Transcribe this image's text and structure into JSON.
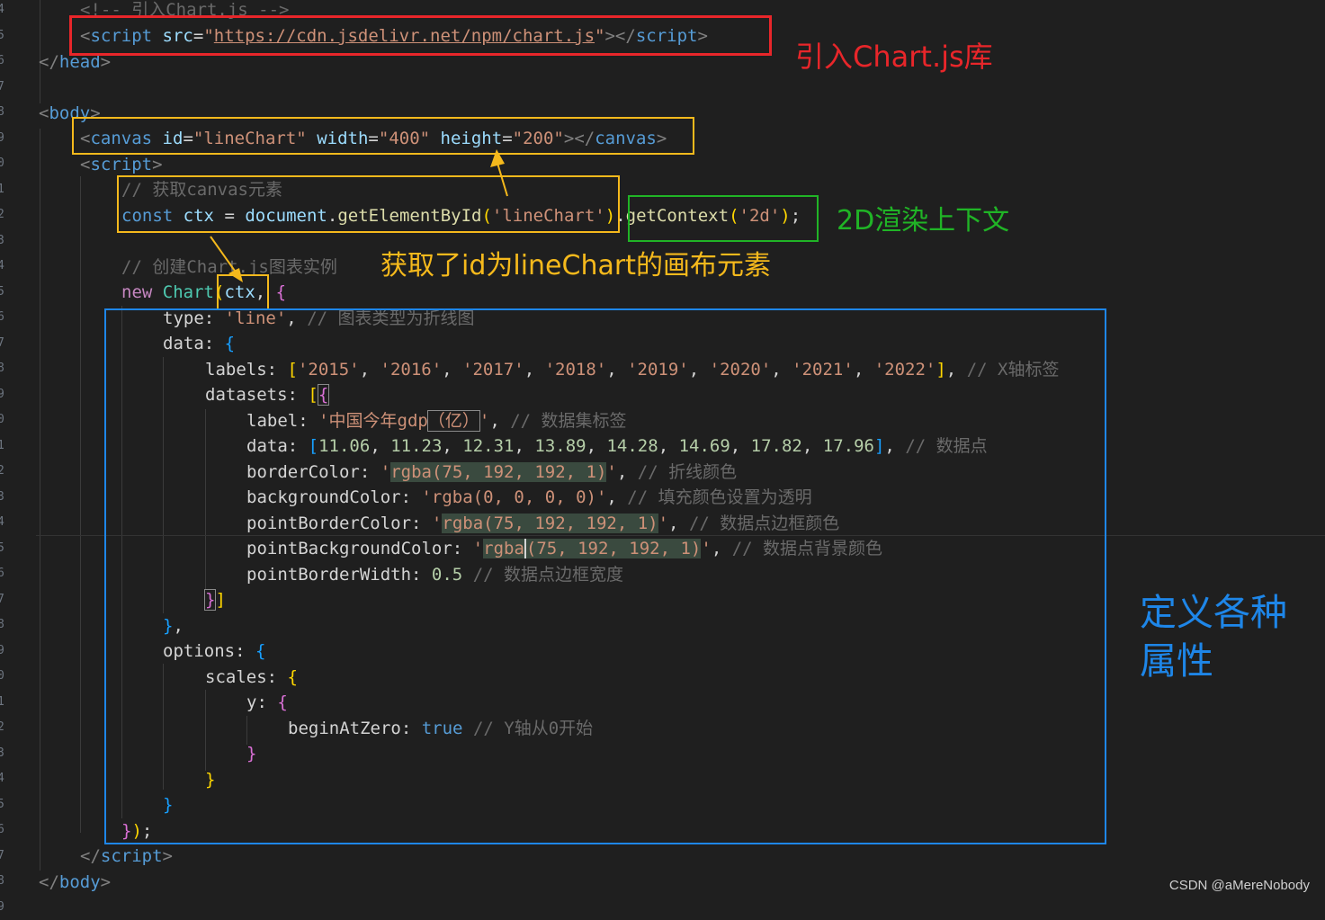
{
  "code": {
    "l01_comment": "<!-- 引入Chart.js -->",
    "l02_url": "https://cdn.jsdelivr.net/npm/chart.js",
    "l08_id": "lineChart",
    "l08_width": "400",
    "l08_height": "200",
    "l10_comment": "// 获取canvas元素",
    "l11_arg": "'lineChart'",
    "l11_ctx": "'2d'",
    "l13_comment": "// 创建Chart.js图表实例",
    "l15_type": "'line'",
    "l15_comment": "// 图表类型为折线图",
    "labels": [
      "'2015'",
      "'2016'",
      "'2017'",
      "'2018'",
      "'2019'",
      "'2020'",
      "'2021'",
      "'2022'"
    ],
    "labels_comment": "// X轴标签",
    "ds_label_a": "'中国今年gdp",
    "ds_label_b": "（亿）",
    "ds_label_c": "'",
    "ds_label_comment": "// 数据集标签",
    "ds_data": [
      "11.06",
      "11.23",
      "12.31",
      "13.89",
      "14.28",
      "14.69",
      "17.82",
      "17.96"
    ],
    "ds_data_comment": "// 数据点",
    "border_color": "rgba(75, 192, 192, 1)",
    "border_comment": "// 折线颜色",
    "bg_color": "'rgba(0, 0, 0, 0)'",
    "bg_comment": "// 填充颜色设置为透明",
    "point_border_color": "rgba(75, 192, 192, 1)",
    "point_border_comment": "// 数据点边框颜色",
    "pbg_a": "rgba",
    "pbg_b": "(75, 192, 192, 1)",
    "pbg_comment": "// 数据点背景颜色",
    "pbw_value": "0.5",
    "pbw_comment": "// 数据点边框宽度",
    "begin_comment": "// Y轴从0开始"
  },
  "annotations": {
    "import_lib": "引入Chart.js库",
    "ctx_2d": "2D渲染上下文",
    "get_canvas": "获取了id为lineChart的画布元素",
    "define_props_1": "定义各种",
    "define_props_2": "属性"
  },
  "watermark": "CSDN @aMereNobody",
  "colors": {
    "red": "#e8262a",
    "orange": "#f5b91c",
    "green": "#20b426",
    "blue": "#1e86e8"
  }
}
